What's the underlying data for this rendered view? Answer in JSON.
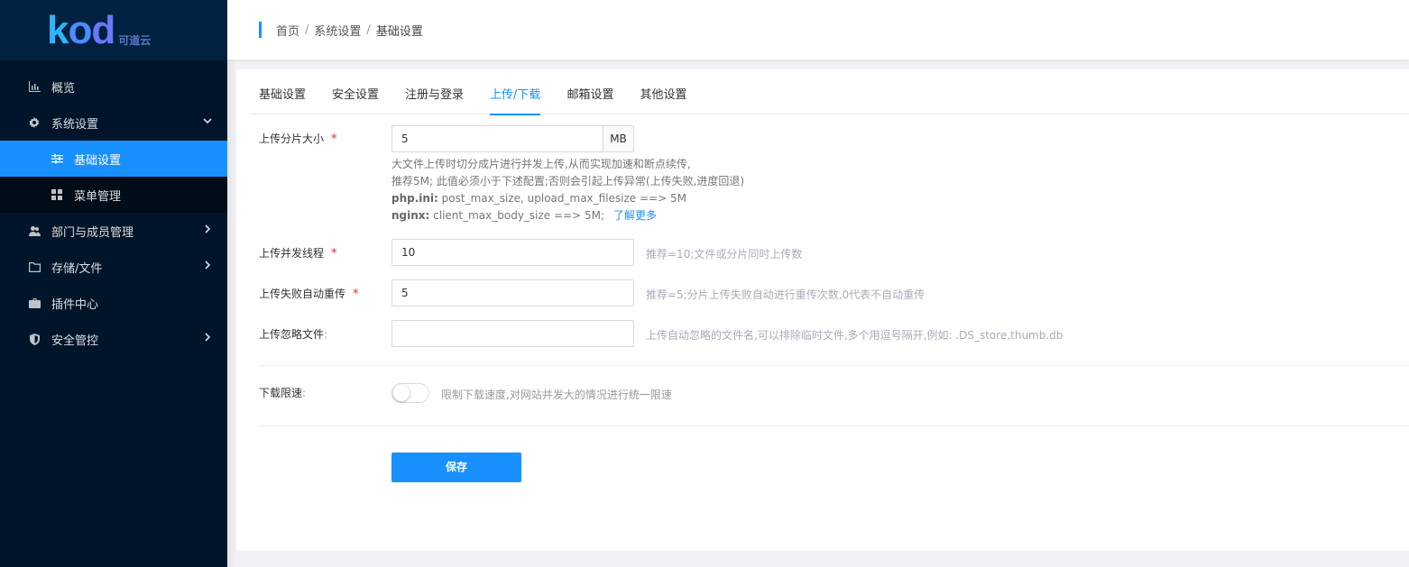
{
  "logo": {
    "text_k": "k",
    "text_o": "o",
    "text_d": "d",
    "sub": "可道云"
  },
  "sidebar": {
    "items": [
      {
        "label": "概览",
        "icon": "bar-chart-icon"
      },
      {
        "label": "系统设置",
        "icon": "gear-icon",
        "expanded": true
      },
      {
        "label": "基础设置",
        "icon": "sliders-icon",
        "active": true
      },
      {
        "label": "菜单管理",
        "icon": "grid-icon"
      },
      {
        "label": "部门与成员管理",
        "icon": "users-icon"
      },
      {
        "label": "存储/文件",
        "icon": "folder-icon"
      },
      {
        "label": "插件中心",
        "icon": "briefcase-icon"
      },
      {
        "label": "安全管控",
        "icon": "shield-icon"
      }
    ]
  },
  "breadcrumb": {
    "home": "首页",
    "sep": "/",
    "parent": "系统设置",
    "current": "基础设置"
  },
  "tabs": [
    "基础设置",
    "安全设置",
    "注册与登录",
    "上传/下载",
    "邮箱设置",
    "其他设置"
  ],
  "form": {
    "chunk": {
      "label": "上传分片大小",
      "required": "*",
      "value": "5",
      "unit": "MB",
      "desc1": "大文件上传时切分成片进行并发上传,从而实现加速和断点续传,",
      "desc2": "推荐5M; 此值必须小于下述配置;否则会引起上传异常(上传失败,进度回退)",
      "desc3_b": "php.ini:",
      "desc3": " post_max_size, upload_max_filesize ==> 5M",
      "desc4_b": "nginx:",
      "desc4": " client_max_body_size ==> 5M;",
      "more": "了解更多"
    },
    "threads": {
      "label": "上传并发线程",
      "required": "*",
      "value": "10",
      "hint": "推荐=10;文件或分片同时上传数"
    },
    "retry": {
      "label": "上传失败自动重传",
      "required": "*",
      "value": "5",
      "hint": "推荐=5;分片上传失败自动进行重传次数,0代表不自动重传"
    },
    "ignore": {
      "label": "上传忽略文件",
      "value": "",
      "hint": "上传自动忽略的文件名,可以排除临时文件,多个用逗号隔开,例如: .DS_store,thumb.db"
    },
    "speed": {
      "label": "下载限速",
      "enabled": false,
      "hint": "限制下载速度,对网站并发大的情况进行统一限速"
    },
    "colon": ":",
    "save_label": "保存"
  },
  "colors": {
    "accent": "#1890ff",
    "sidebar_bg": "#001529",
    "required": "#f5222d"
  }
}
